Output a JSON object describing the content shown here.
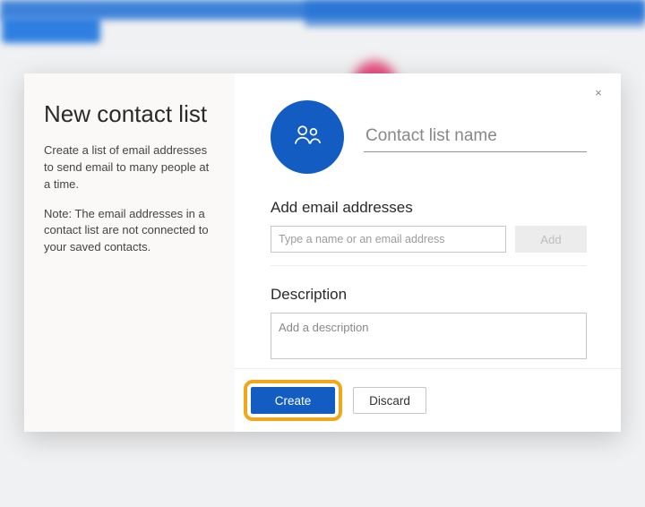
{
  "colors": {
    "primary": "#135cc2",
    "highlight_ring": "#f2a619"
  },
  "left": {
    "title": "New contact list",
    "intro": "Create a list of email addresses to send email to many people at a time.",
    "note": "Note: The email addresses in a contact list are not connected to your saved contacts."
  },
  "right": {
    "close_glyph": "×",
    "name_placeholder": "Contact list name",
    "name_value": "",
    "emails": {
      "heading": "Add email addresses",
      "input_placeholder": "Type a name or an email address",
      "input_value": "",
      "add_label": "Add",
      "add_enabled": false
    },
    "description": {
      "heading": "Description",
      "placeholder": "Add a description",
      "value": ""
    }
  },
  "footer": {
    "primary_label": "Create",
    "secondary_label": "Discard",
    "primary_highlighted": true
  }
}
